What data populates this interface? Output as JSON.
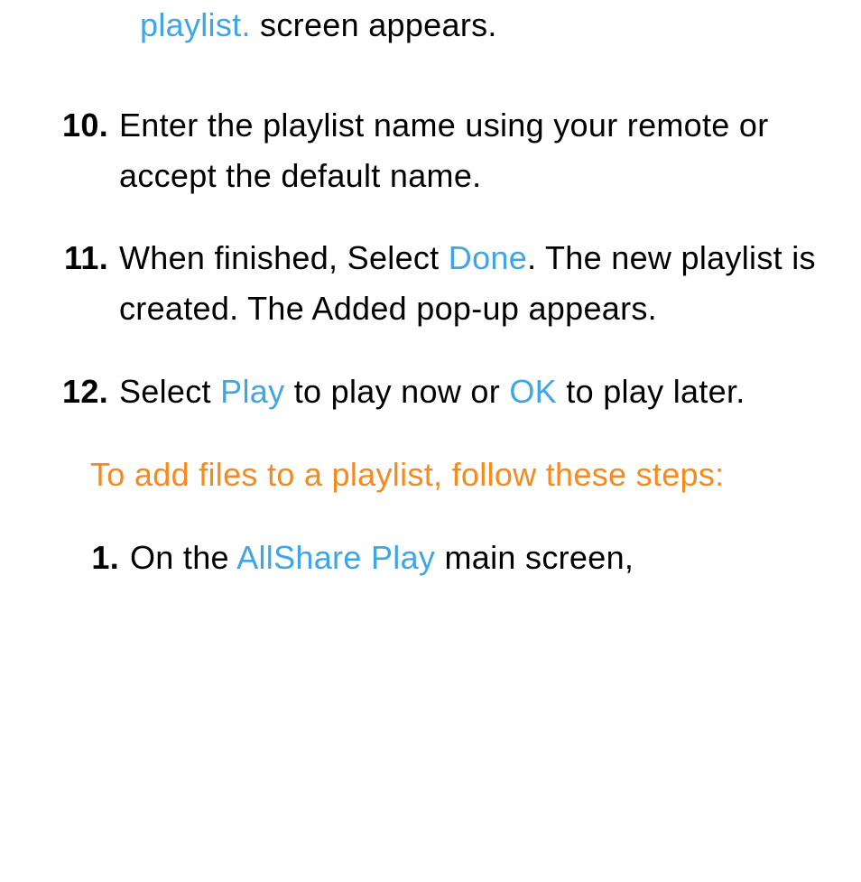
{
  "colors": {
    "blue": "#3ea6e6",
    "orange": "#f68a1e"
  },
  "fragment": {
    "link": "playlist.",
    "tail": " screen appears."
  },
  "steps": [
    {
      "num": "10.",
      "runs": [
        {
          "t": "Enter the playlist name using your remote or accept the default name."
        }
      ]
    },
    {
      "num": "11.",
      "runs": [
        {
          "t": "When finished, Select "
        },
        {
          "t": "Done",
          "cls": "blue"
        },
        {
          "t": ". The new playlist is created. The Added pop-up appears."
        }
      ]
    },
    {
      "num": "12.",
      "runs": [
        {
          "t": "Select "
        },
        {
          "t": "Play",
          "cls": "blue"
        },
        {
          "t": " to play now or "
        },
        {
          "t": "OK",
          "cls": "blue"
        },
        {
          "t": " to play later."
        }
      ]
    }
  ],
  "section_heading": "To add files to a playlist, follow these steps:",
  "substeps": [
    {
      "num": "1.",
      "runs": [
        {
          "t": "On the "
        },
        {
          "t": "AllShare Play",
          "cls": "blue"
        },
        {
          "t": " main screen,"
        }
      ]
    }
  ]
}
